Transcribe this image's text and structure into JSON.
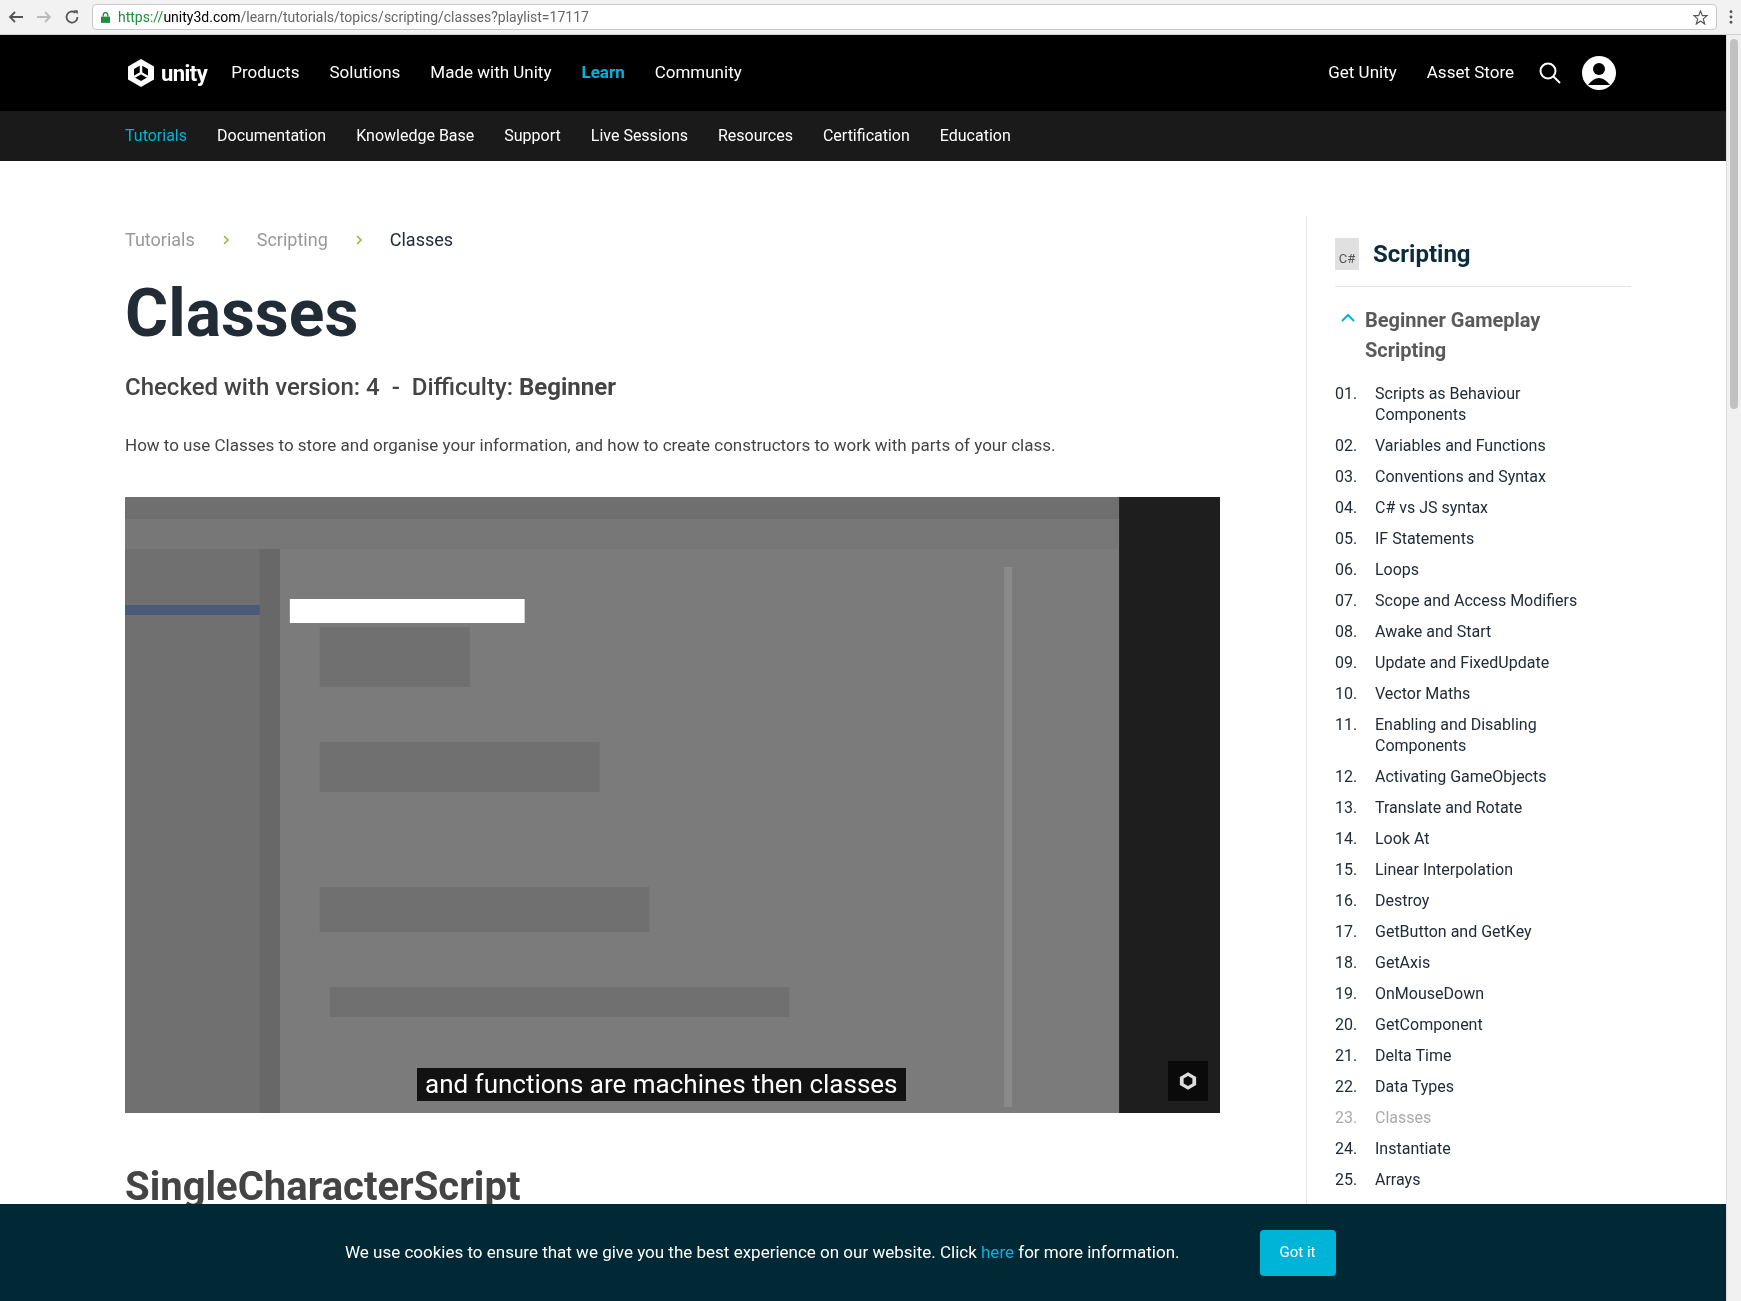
{
  "browser": {
    "scheme": "https://",
    "host": "unity3d.com",
    "path": "/learn/tutorials/topics/scripting/classes?playlist=17117"
  },
  "nav": {
    "logo_text": "unity",
    "items": [
      {
        "label": "Products",
        "selected": false
      },
      {
        "label": "Solutions",
        "selected": false
      },
      {
        "label": "Made with Unity",
        "selected": false
      },
      {
        "label": "Learn",
        "selected": true
      },
      {
        "label": "Community",
        "selected": false
      }
    ],
    "right_links": [
      "Get Unity",
      "Asset Store"
    ]
  },
  "subnav": [
    {
      "label": "Tutorials",
      "selected": true
    },
    {
      "label": "Documentation",
      "selected": false
    },
    {
      "label": "Knowledge Base",
      "selected": false
    },
    {
      "label": "Support",
      "selected": false
    },
    {
      "label": "Live Sessions",
      "selected": false
    },
    {
      "label": "Resources",
      "selected": false
    },
    {
      "label": "Certification",
      "selected": false
    },
    {
      "label": "Education",
      "selected": false
    }
  ],
  "breadcrumbs": [
    {
      "label": "Tutorials",
      "current": false
    },
    {
      "label": "Scripting",
      "current": false
    },
    {
      "label": "Classes",
      "current": true
    }
  ],
  "title": "Classes",
  "meta": "Checked with version: 4  -  Difficulty: **Beginner**",
  "description": "How to use Classes to store and organise your information, and how to create constructors to work with parts of your class.",
  "video": {
    "caption": "and functions are machines then classes"
  },
  "section_heading": "SingleCharacterScript",
  "sidebar": {
    "icon_text": "C#",
    "title": "Scripting",
    "group": {
      "title": "Beginner Gameplay Scripting",
      "expanded": true,
      "items": [
        {
          "number": "01.",
          "label": "Scripts as Behaviour Components",
          "selected": false
        },
        {
          "number": "02.",
          "label": "Variables and Functions",
          "selected": false
        },
        {
          "number": "03.",
          "label": "Conventions and Syntax",
          "selected": false
        },
        {
          "number": "04.",
          "label": "C# vs JS syntax",
          "selected": false
        },
        {
          "number": "05.",
          "label": "IF Statements",
          "selected": false
        },
        {
          "number": "06.",
          "label": "Loops",
          "selected": false
        },
        {
          "number": "07.",
          "label": "Scope and Access Modifiers",
          "selected": false
        },
        {
          "number": "08.",
          "label": "Awake and Start",
          "selected": false
        },
        {
          "number": "09.",
          "label": "Update and FixedUpdate",
          "selected": false
        },
        {
          "number": "10.",
          "label": "Vector Maths",
          "selected": false
        },
        {
          "number": "11.",
          "label": "Enabling and Disabling Components",
          "selected": false
        },
        {
          "number": "12.",
          "label": "Activating GameObjects",
          "selected": false
        },
        {
          "number": "13.",
          "label": "Translate and Rotate",
          "selected": false
        },
        {
          "number": "14.",
          "label": "Look At",
          "selected": false
        },
        {
          "number": "15.",
          "label": "Linear Interpolation",
          "selected": false
        },
        {
          "number": "16.",
          "label": "Destroy",
          "selected": false
        },
        {
          "number": "17.",
          "label": "GetButton and GetKey",
          "selected": false
        },
        {
          "number": "18.",
          "label": "GetAxis",
          "selected": false
        },
        {
          "number": "19.",
          "label": "OnMouseDown",
          "selected": false
        },
        {
          "number": "20.",
          "label": "GetComponent",
          "selected": false
        },
        {
          "number": "21.",
          "label": "Delta Time",
          "selected": false
        },
        {
          "number": "22.",
          "label": "Data Types",
          "selected": false
        },
        {
          "number": "23.",
          "label": "Classes",
          "selected": true
        },
        {
          "number": "24.",
          "label": "Instantiate",
          "selected": false
        },
        {
          "number": "25.",
          "label": "Arrays",
          "selected": false
        }
      ]
    }
  },
  "cookie": {
    "text_before": "We use cookies to ensure that we give you the best experience on our website. Click",
    "link": "here",
    "text_after": "for more information.",
    "button": "Got it"
  }
}
